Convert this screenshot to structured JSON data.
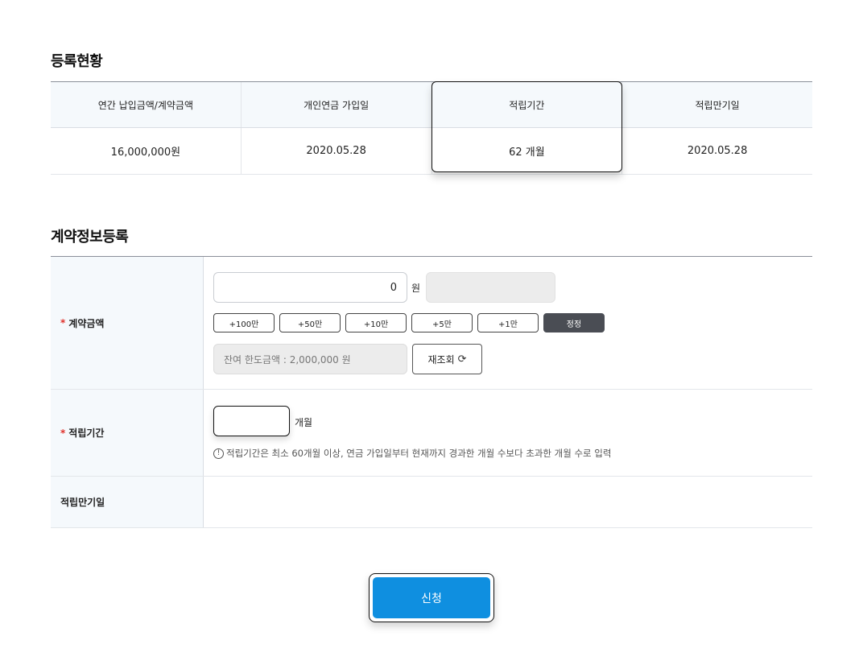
{
  "status": {
    "title": "등록현황",
    "columns": [
      "연간 납입금액/계약금액",
      "개인연금 가입일",
      "적립기간",
      "적립만기일"
    ],
    "values": [
      "16,000,000원",
      "2020.05.28",
      "62 개월",
      "2020.05.28"
    ]
  },
  "register": {
    "title": "계약정보등록",
    "required_mark": "*",
    "amount": {
      "label": "계약금액",
      "value": "0",
      "unit": "원",
      "quick_buttons": [
        "+100만",
        "+50만",
        "+10만",
        "+5만",
        "+1만"
      ],
      "correct_label": "정정",
      "limit_text": "잔여 한도금액 : 2,000,000 원",
      "reload_label": "재조회",
      "reload_icon": "refresh-icon"
    },
    "period": {
      "label": "적립기간",
      "value": "",
      "unit": "개월",
      "notice": "적립기간은 최소 60개월 이상, 연금 가입일부터 현재까지 경과한 개월 수보다 초과한 개월 수로 입력",
      "notice_icon": "info-icon"
    },
    "maturity": {
      "label": "적립만기일",
      "value": ""
    }
  },
  "apply_label": "신청",
  "colors": {
    "accent": "#0f8fe0",
    "required": "#e0302a",
    "header_bg": "#f5f9fc",
    "dark_button": "#4a4d54"
  }
}
